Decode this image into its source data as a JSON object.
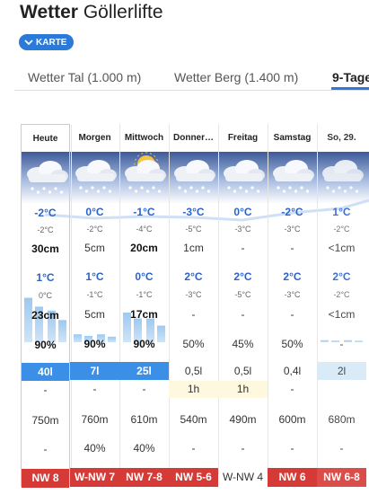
{
  "header": {
    "title_bold": "Wetter",
    "title_rest": "Göllerlifte",
    "karte_label": "KARTE"
  },
  "tabs": [
    {
      "label": "Wetter Tal (1.000 m)",
      "active": false
    },
    {
      "label": "Wetter Berg (1.400 m)",
      "active": false
    },
    {
      "label": "9-Tage",
      "active": true
    }
  ],
  "days": [
    {
      "name": "Heute",
      "tmax": "-2°C",
      "tmin": "-2°C",
      "snow": "30cm",
      "t2max": "1°C",
      "t2min": "0°C",
      "snow2": "23cm",
      "prob": "90%",
      "rain": "40l",
      "sun": "-",
      "fog": "750m",
      "chance": "-",
      "wind": "NW 8",
      "snow_level": 0.45,
      "snow2_level": 0.32,
      "sky": "cloudy"
    },
    {
      "name": "Morgen",
      "tmax": "0°C",
      "tmin": "-2°C",
      "snow": "5cm",
      "t2max": "1°C",
      "t2min": "-1°C",
      "snow2": "5cm",
      "prob": "90%",
      "rain": "7l",
      "sun": "-",
      "fog": "760m",
      "chance": "40%",
      "wind": "W-NW 7",
      "snow_level": 0.08,
      "snow2_level": 0.08,
      "sky": "cloudy"
    },
    {
      "name": "Mittwoch",
      "tmax": "-1°C",
      "tmin": "-4°C",
      "snow": "20cm",
      "t2max": "0°C",
      "t2min": "-1°C",
      "snow2": "17cm",
      "prob": "90%",
      "rain": "25l",
      "sun": "-",
      "fog": "610m",
      "chance": "40%",
      "wind": "NW 7-8",
      "snow_level": 0.3,
      "snow2_level": 0.24,
      "sky": "partly"
    },
    {
      "name": "Donner…",
      "tmax": "-3°C",
      "tmin": "-5°C",
      "snow": "1cm",
      "t2max": "2°C",
      "t2min": "-3°C",
      "snow2": "-",
      "prob": "50%",
      "rain": "0,5l",
      "sun": "1h",
      "fog": "540m",
      "chance": "-",
      "wind": "NW 5-6",
      "snow_level": 0,
      "snow2_level": 0,
      "sky": "cloudy"
    },
    {
      "name": "Freitag",
      "tmax": "0°C",
      "tmin": "-3°C",
      "snow": "-",
      "t2max": "2°C",
      "t2min": "-5°C",
      "snow2": "-",
      "prob": "45%",
      "rain": "0,5l",
      "sun": "1h",
      "fog": "490m",
      "chance": "-",
      "wind": "W-NW 4",
      "snow_level": 0,
      "snow2_level": 0,
      "sky": "cloudy"
    },
    {
      "name": "Samstag",
      "tmax": "-2°C",
      "tmin": "-3°C",
      "snow": "-",
      "t2max": "2°C",
      "t2min": "-3°C",
      "snow2": "-",
      "prob": "50%",
      "rain": "0,4l",
      "sun": "-",
      "fog": "600m",
      "chance": "-",
      "wind": "NW 6",
      "snow_level": 0,
      "snow2_level": 0,
      "sky": "cloudy"
    },
    {
      "name": "So, 29.",
      "tmax": "1°C",
      "tmin": "-2°C",
      "snow": "<1cm",
      "t2max": "2°C",
      "t2min": "-2°C",
      "snow2": "<1cm",
      "prob": "-",
      "rain": "2l",
      "sun": "",
      "fog": "680m",
      "chance": "-",
      "wind": "NW 6-8",
      "snow_level": 0.02,
      "snow2_level": 0.02,
      "sky": "cloudy"
    }
  ],
  "colors": {
    "accent": "#2b7ad9",
    "wind": "#d63a36",
    "rain_high": "#3b8fe6",
    "temp": "#2b63c9",
    "sun_bg": "#fdf8de"
  }
}
